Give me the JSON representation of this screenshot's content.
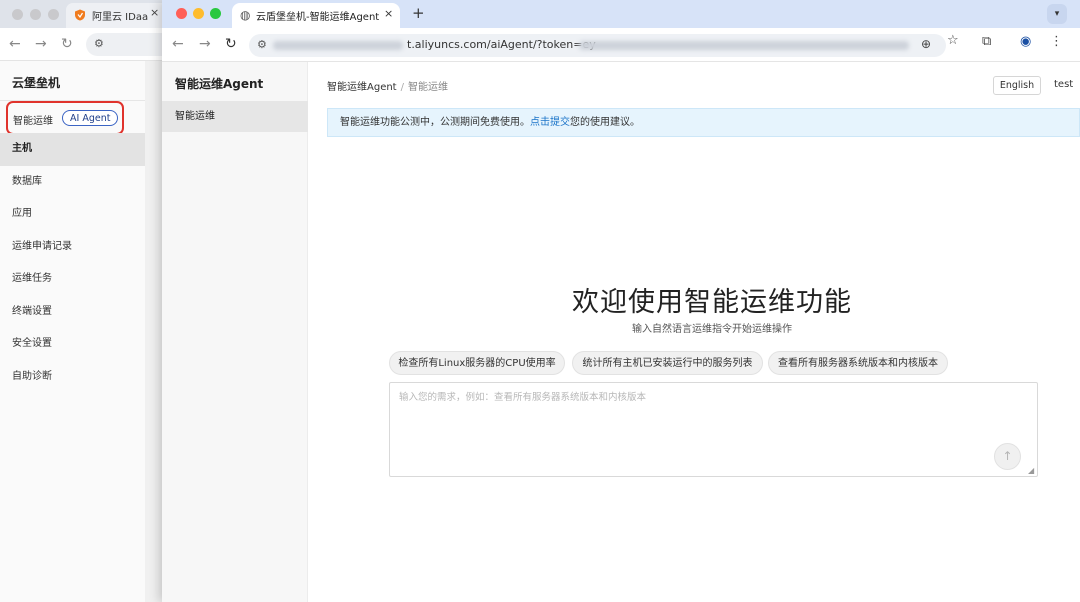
{
  "back_window": {
    "tab_title": "阿里云 IDaaS",
    "tab_close": "×",
    "app_title": "云堡垒机",
    "ai_label": "智能运维",
    "ai_badge": "AI Agent",
    "menu": [
      {
        "label": "主机",
        "active": true
      },
      {
        "label": "数据库",
        "active": false
      },
      {
        "label": "应用",
        "active": false
      },
      {
        "label": "运维申请记录",
        "active": false
      },
      {
        "label": "运维任务",
        "active": false
      },
      {
        "label": "终端设置",
        "active": false
      },
      {
        "label": "安全设置",
        "active": false
      },
      {
        "label": "自助诊断",
        "active": false
      }
    ]
  },
  "browser": {
    "tab_title": "云盾堡垒机-智能运维Agent",
    "tab_close": "×",
    "new_tab": "+",
    "url": "t.aliyuncs.com/aiAgent/?token=ey",
    "icons": {
      "back": "←",
      "forward": "→",
      "reload": "↻",
      "zoom": "⊕",
      "bookmark": "☆",
      "extensions": "⧉",
      "profile": "◉",
      "menu": "⋮",
      "dropdown": "▾",
      "site_info": "⚙",
      "globe": "◍"
    },
    "colors": {
      "close": "#ff5f57",
      "minimize": "#febc2e",
      "maximize": "#28c840"
    }
  },
  "app": {
    "sidebar_title": "智能运维Agent",
    "nav_item": "智能运维",
    "breadcrumb": [
      "智能运维Agent",
      "/",
      "智能运维"
    ],
    "lang_button": "English",
    "user": "test",
    "notice": {
      "before": "智能运维功能公测中，公测期间免费使用。",
      "link": "点击提交",
      "after": "您的使用建议。"
    },
    "welcome_title": "欢迎使用智能运维功能",
    "welcome_subtitle": "输入自然语言运维指令开始运维操作",
    "suggestions": [
      "检查所有Linux服务器的CPU使用率",
      "统计所有主机已安装运行中的服务列表",
      "查看所有服务器系统版本和内核版本"
    ],
    "prompt_placeholder": "输入您的需求，例如：查看所有服务器系统版本和内核版本",
    "send_icon": "↑",
    "resize_icon": "◢"
  }
}
